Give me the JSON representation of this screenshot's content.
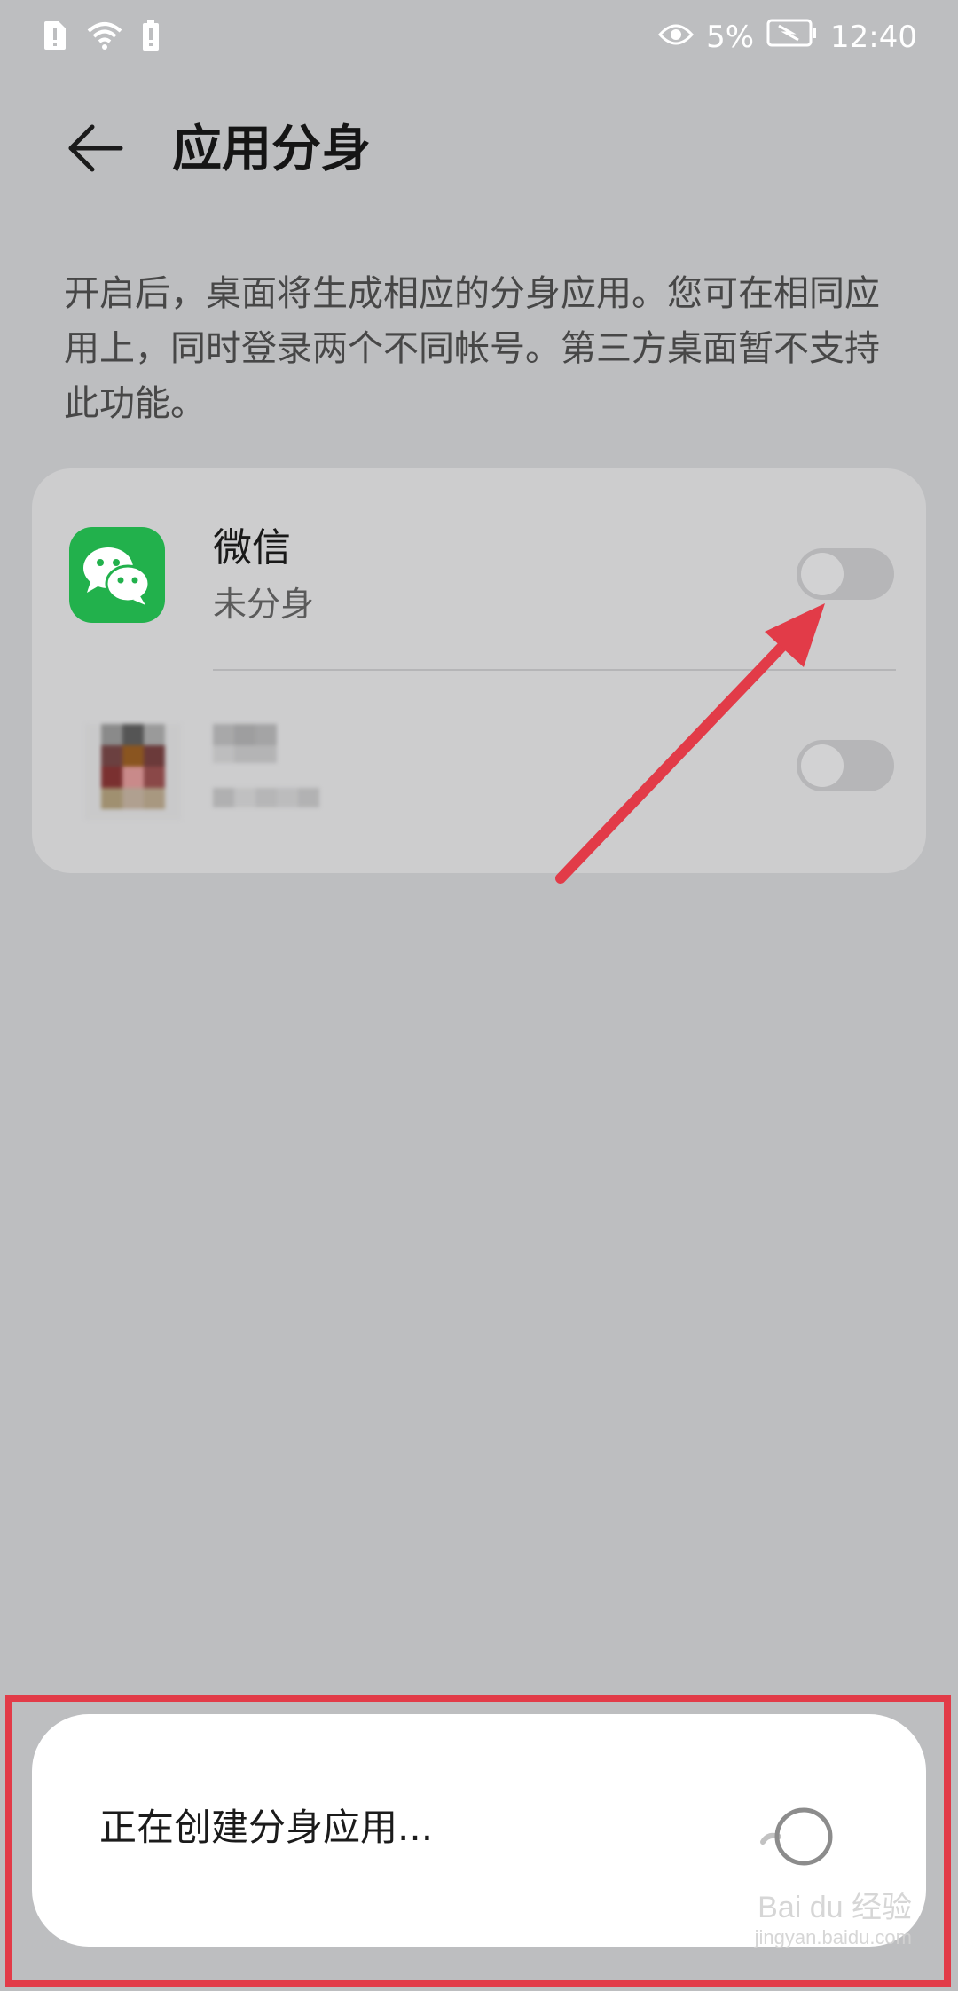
{
  "status_bar": {
    "battery_percent": "5%",
    "time": "12:40"
  },
  "header": {
    "title": "应用分身"
  },
  "description": "开启后，桌面将生成相应的分身应用。您可在相同应用上，同时登录两个不同帐号。第三方桌面暂不支持此功能。",
  "apps": [
    {
      "name": "微信",
      "status": "未分身",
      "icon": "wechat-icon",
      "toggle_on": false
    },
    {
      "name": "",
      "status": "",
      "icon": "blurred-app-icon",
      "toggle_on": false
    }
  ],
  "toast": {
    "text": "正在创建分身应用..."
  },
  "watermark": {
    "brand": "Bai du 经验",
    "url": "jingyan.baidu.com"
  },
  "colors": {
    "background": "#bdbec0",
    "card": "#cdcdce",
    "wechat_green": "#22b14c",
    "annotation_red": "#e23b48"
  }
}
